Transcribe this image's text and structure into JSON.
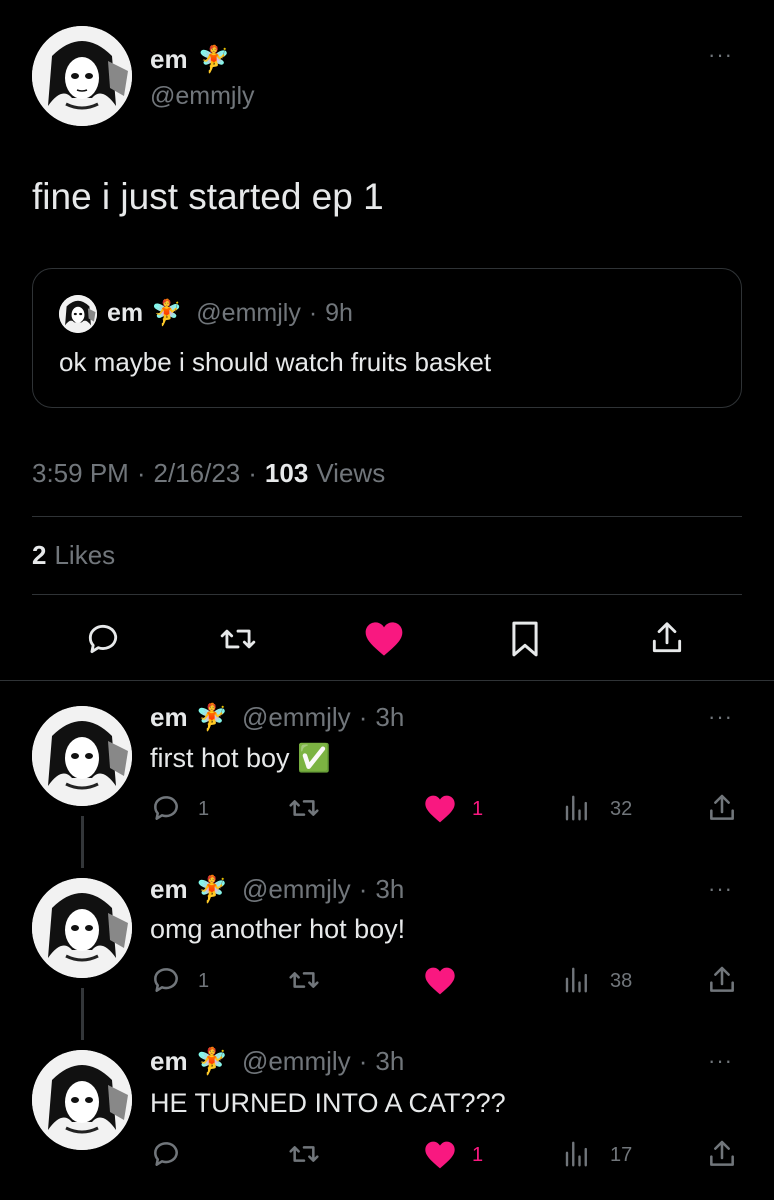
{
  "main_tweet": {
    "display_name": "em",
    "name_emoji": "🧚",
    "handle": "@emmjly",
    "text": "fine i just started ep 1",
    "quote": {
      "display_name": "em",
      "name_emoji": "🧚",
      "handle": "@emmjly",
      "sep": "·",
      "time": "9h",
      "text": "ok maybe i should watch fruits basket"
    },
    "time": "3:59 PM",
    "sep1": "·",
    "date": "2/16/23",
    "sep2": "·",
    "views_count": "103",
    "views_label": "Views",
    "likes_count": "2",
    "likes_label": "Likes",
    "more": "···"
  },
  "replies": [
    {
      "display_name": "em",
      "name_emoji": "🧚",
      "handle": "@emmjly",
      "sep": "·",
      "time": "3h",
      "text": "first hot boy ✅",
      "replies": "1",
      "retweets": "",
      "likes": "1",
      "views": "32",
      "more": "···"
    },
    {
      "display_name": "em",
      "name_emoji": "🧚",
      "handle": "@emmjly",
      "sep": "·",
      "time": "3h",
      "text": "omg another hot boy!",
      "replies": "1",
      "retweets": "",
      "likes": "",
      "views": "38",
      "more": "···"
    },
    {
      "display_name": "em",
      "name_emoji": "🧚",
      "handle": "@emmjly",
      "sep": "·",
      "time": "3h",
      "text": "HE TURNED INTO A CAT???",
      "replies": "",
      "retweets": "",
      "likes": "1",
      "views": "17",
      "more": "···"
    }
  ],
  "colors": {
    "background": "#000000",
    "text": "#e7e9ea",
    "secondary": "#71767b",
    "like_pink": "#f91880",
    "border": "#2f3336"
  },
  "icons": [
    "reply-icon",
    "retweet-icon",
    "heart-icon",
    "bookmark-icon",
    "share-icon",
    "views-icon",
    "more-icon"
  ]
}
